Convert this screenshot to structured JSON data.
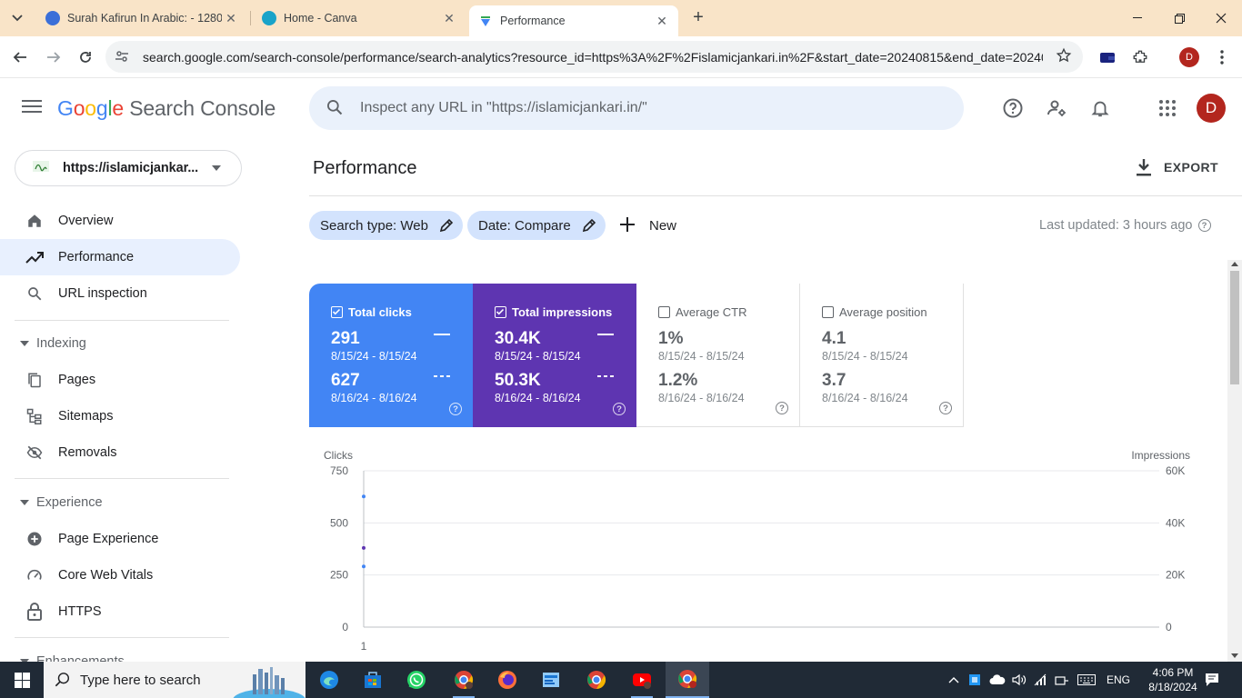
{
  "browser": {
    "tabs": [
      {
        "title": "Surah Kafirun In Arabic: - 1280",
        "active": false
      },
      {
        "title": "Home - Canva",
        "active": false
      },
      {
        "title": "Performance",
        "active": true
      }
    ],
    "new_tab_symbol": "+",
    "url": "search.google.com/search-console/performance/search-analytics?resource_id=https%3A%2F%2Fislamicjankari.in%2F&start_date=20240815&end_date=20240...",
    "profile_initial": "D"
  },
  "header": {
    "logo_google": "Google",
    "logo_product": "Search Console",
    "search_placeholder": "Inspect any URL in \"https://islamicjankari.in/\"",
    "avatar_initial": "D"
  },
  "sidebar": {
    "property_label": "https://islamicjankar...",
    "items_top": [
      {
        "label": "Overview",
        "icon": "home-icon",
        "active": false
      },
      {
        "label": "Performance",
        "icon": "trending-up-icon",
        "active": true
      },
      {
        "label": "URL inspection",
        "icon": "search-icon",
        "active": false
      }
    ],
    "indexing": {
      "header": "Indexing",
      "items": [
        {
          "label": "Pages",
          "icon": "pages-icon"
        },
        {
          "label": "Sitemaps",
          "icon": "sitemap-icon"
        },
        {
          "label": "Removals",
          "icon": "eye-off-icon"
        }
      ]
    },
    "experience": {
      "header": "Experience",
      "items": [
        {
          "label": "Page Experience",
          "icon": "add-circle-icon"
        },
        {
          "label": "Core Web Vitals",
          "icon": "speed-icon"
        },
        {
          "label": "HTTPS",
          "icon": "lock-icon"
        }
      ]
    },
    "enhancements_header": "Enhancements"
  },
  "main": {
    "title": "Performance",
    "export_label": "EXPORT",
    "chips": {
      "search_type": "Search type: Web",
      "date": "Date: Compare"
    },
    "new_label": "New",
    "last_updated": "Last updated: 3 hours ago",
    "metrics": {
      "clicks": {
        "label": "Total clicks",
        "v1": "291",
        "d1": "8/15/24 - 8/15/24",
        "v2": "627",
        "d2": "8/16/24 - 8/16/24",
        "checked": true,
        "color": "#4285f4"
      },
      "impressions": {
        "label": "Total impressions",
        "v1": "30.4K",
        "d1": "8/15/24 - 8/15/24",
        "v2": "50.3K",
        "d2": "8/16/24 - 8/16/24",
        "checked": true,
        "color": "#5e35b1"
      },
      "ctr": {
        "label": "Average CTR",
        "v1": "1%",
        "d1": "8/15/24 - 8/15/24",
        "v2": "1.2%",
        "d2": "8/16/24 - 8/16/24",
        "checked": false
      },
      "position": {
        "label": "Average position",
        "v1": "4.1",
        "d1": "8/15/24 - 8/15/24",
        "v2": "3.7",
        "d2": "8/16/24 - 8/16/24",
        "checked": false
      }
    }
  },
  "chart_data": {
    "type": "scatter",
    "x": [
      1
    ],
    "series": [
      {
        "name": "Clicks",
        "axis": "left",
        "values": [
          627
        ],
        "color": "#4285f4"
      },
      {
        "name": "Clicks",
        "axis": "left",
        "values": [
          291
        ],
        "color": "#4285f4"
      },
      {
        "name": "Impressions",
        "axis": "right",
        "values": [
          30400
        ],
        "color": "#5e35b1"
      }
    ],
    "left_axis": {
      "label": "Clicks",
      "ticks": [
        "750",
        "500",
        "250",
        "0"
      ],
      "tick_values": [
        750,
        500,
        250,
        0
      ],
      "range": [
        0,
        750
      ]
    },
    "right_axis": {
      "label": "Impressions",
      "ticks": [
        "60K",
        "40K",
        "20K",
        "0"
      ],
      "tick_values": [
        60000,
        40000,
        20000,
        0
      ],
      "range": [
        0,
        60000
      ]
    },
    "x_ticks": [
      "1"
    ],
    "grid": true
  },
  "taskbar": {
    "search_placeholder": "Type here to search",
    "language": "ENG",
    "time": "4:06 PM",
    "date": "8/18/2024"
  }
}
